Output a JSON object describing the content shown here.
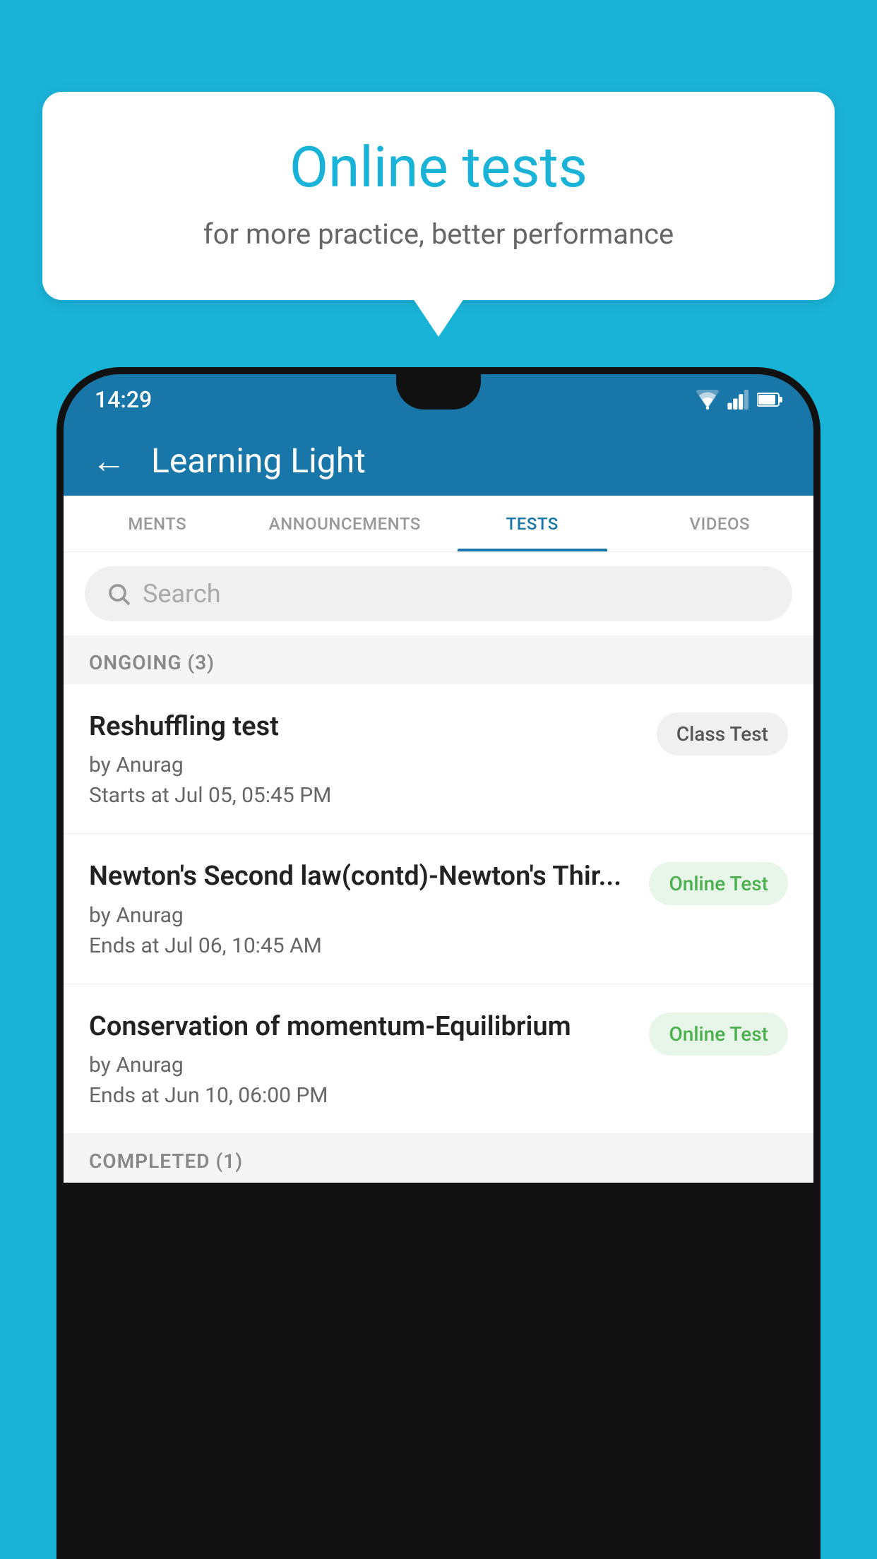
{
  "background_color": "#1ab3d8",
  "bubble": {
    "title": "Online tests",
    "subtitle": "for more practice, better performance"
  },
  "phone": {
    "status_bar": {
      "time": "14:29",
      "icons": [
        "wifi",
        "signal",
        "battery"
      ]
    },
    "header": {
      "back_label": "←",
      "title": "Learning Light"
    },
    "tabs": [
      {
        "label": "MENTS",
        "active": false
      },
      {
        "label": "ANNOUNCEMENTS",
        "active": false
      },
      {
        "label": "TESTS",
        "active": true
      },
      {
        "label": "VIDEOS",
        "active": false
      }
    ],
    "search": {
      "placeholder": "Search"
    },
    "sections": [
      {
        "label": "ONGOING (3)",
        "items": [
          {
            "name": "Reshuffling test",
            "by": "by Anurag",
            "time_label": "Starts at",
            "time": "Jul 05, 05:45 PM",
            "badge": "Class Test",
            "badge_type": "class"
          },
          {
            "name": "Newton's Second law(contd)-Newton's Thir...",
            "by": "by Anurag",
            "time_label": "Ends at",
            "time": "Jul 06, 10:45 AM",
            "badge": "Online Test",
            "badge_type": "online"
          },
          {
            "name": "Conservation of momentum-Equilibrium",
            "by": "by Anurag",
            "time_label": "Ends at",
            "time": "Jun 10, 06:00 PM",
            "badge": "Online Test",
            "badge_type": "online"
          }
        ]
      },
      {
        "label": "COMPLETED (1)",
        "items": []
      }
    ]
  }
}
